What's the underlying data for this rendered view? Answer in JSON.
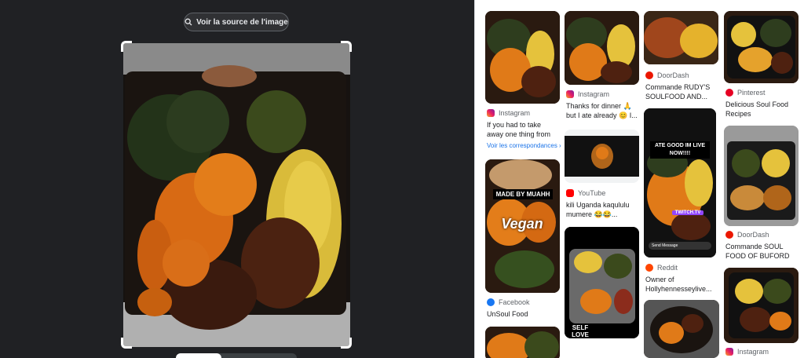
{
  "viewer": {
    "source_button": "Voir la source de l'image"
  },
  "results": [
    {
      "source": "Instagram",
      "favicon": "instagram-icon",
      "title": "If you had to take away one thing from this...",
      "more": "Voir les correspondances"
    },
    {
      "source": "YouTube",
      "favicon": "youtube-icon",
      "title": "kili Uganda kaqululu mumere 😂😂..."
    },
    {
      "source": "Facebook",
      "favicon": "facebook-icon",
      "title": "UnSoul Food",
      "overlay_top": "MADE BY MUAHH",
      "overlay_main": "Vegan"
    },
    {
      "source": "Instagram",
      "favicon": "instagram-icon",
      "title": "Thanks for dinner 🙏 but I ate already 😊 I..."
    },
    {
      "source": "DoorDash",
      "favicon": "doordash-icon",
      "title": "Commande RUDY'S SOULFOOD AND..."
    },
    {
      "source": "Reddit",
      "favicon": "reddit-icon",
      "title": "Owner of Hollyhennesseylive...",
      "overlay_top": "ATE GOOD IM LIVE NOW!!!!",
      "overlay_tag": "TWITCH.TV",
      "overlay_msg": "Send Message"
    },
    {
      "source": "Pinterest",
      "favicon": "pinterest-icon",
      "title": "Delicious Soul Food Recipes"
    },
    {
      "source": "DoorDash",
      "favicon": "doordash-icon",
      "title": "Commande SOUL FOOD OF BUFORD -..."
    },
    {
      "source": "Instagram",
      "favicon": "instagram-icon",
      "title": ""
    },
    {
      "overlay_bottom": "SELF LOVE"
    }
  ],
  "colors": {
    "viewer_bg": "#202124",
    "link_blue": "#1a73e8",
    "text_secondary": "#5f6368"
  }
}
